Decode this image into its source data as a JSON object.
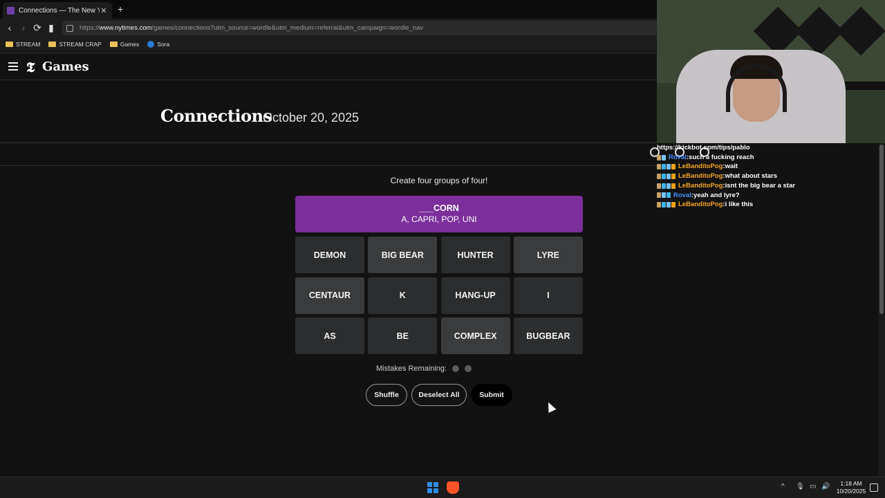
{
  "browser": {
    "tab_title": "Connections — The New York Ti",
    "tab_close": "✕",
    "new_tab": "+",
    "nav": {
      "back": "‹",
      "forward": "›",
      "reload": "⟳",
      "bookmark": "▮"
    },
    "url_prefix": "https://",
    "url_domain": "www.nytimes.com",
    "url_path": "/games/connections?utm_source=wordle&utm_medium=referral&utm_campaign=wordle_nav",
    "bookmarks": [
      "STREAM",
      "STREAM CRAP",
      "Games",
      "Sora"
    ]
  },
  "site": {
    "logo_glyph": "𝕿",
    "title": "Games"
  },
  "game": {
    "title": "Connections",
    "date": "October 20, 2025",
    "instructions": "Create four groups of four!",
    "solved_group": {
      "title": "___CORN",
      "members": "A, CAPRI, POP, UNI",
      "color": "#7c2f9a"
    },
    "tiles": [
      {
        "label": "DEMON",
        "selected": false
      },
      {
        "label": "BIG BEAR",
        "selected": true
      },
      {
        "label": "HUNTER",
        "selected": false
      },
      {
        "label": "LYRE",
        "selected": true
      },
      {
        "label": "CENTAUR",
        "selected": true
      },
      {
        "label": "K",
        "selected": false
      },
      {
        "label": "HANG-UP",
        "selected": false
      },
      {
        "label": "I",
        "selected": false
      },
      {
        "label": "AS",
        "selected": false
      },
      {
        "label": "BE",
        "selected": false
      },
      {
        "label": "COMPLEX",
        "selected": true
      },
      {
        "label": "BUGBEAR",
        "selected": false
      }
    ],
    "mistakes_label": "Mistakes Remaining:",
    "mistakes_remaining": 2,
    "buttons": {
      "shuffle": "Shuffle",
      "deselect": "Deselect All",
      "submit": "Submit"
    }
  },
  "chat": {
    "tip_url": "https://kickbot.com/tips/pablo",
    "messages": [
      {
        "user": "Roval",
        "text": "such a fucking reach",
        "color": "blue"
      },
      {
        "user": "LeBanditoPog",
        "text": "wait",
        "color": "orange"
      },
      {
        "user": "LeBanditoPog",
        "text": "what about stars",
        "color": "orange"
      },
      {
        "user": "LeBanditoPog",
        "text": "isnt the big bear a star",
        "color": "orange"
      },
      {
        "user": "Roval",
        "text": "yeah and lyre?",
        "color": "blue"
      },
      {
        "user": "LeBanditoPog",
        "text": "i like this",
        "color": "orange"
      }
    ]
  },
  "taskbar": {
    "time": "1:18 AM",
    "date": "10/20/2025"
  },
  "colors": {
    "background": "#121213",
    "tile": "#2b2d2e",
    "tile_selected": "#3a3b3c",
    "purple_group": "#7c2f9a",
    "username_orange": "#f5a623",
    "username_blue": "#4a8cff"
  }
}
